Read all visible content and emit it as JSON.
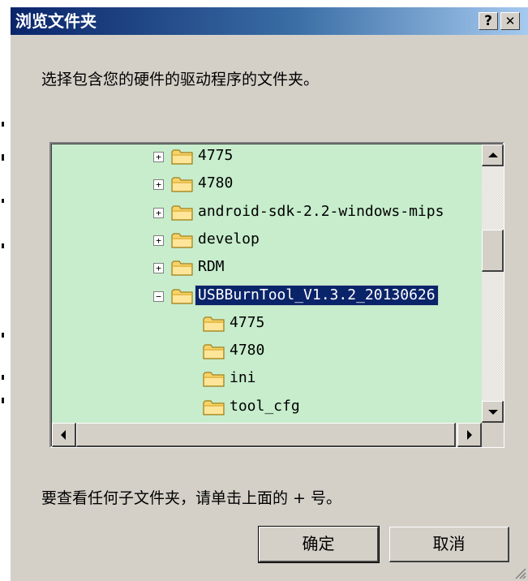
{
  "window": {
    "title": "浏览文件夹",
    "help_label": "?",
    "close_label": "✕"
  },
  "prompt": "选择包含您的硬件的驱动程序的文件夹。",
  "tree": {
    "rows": [
      {
        "label": "4775",
        "expander": "+",
        "level": 1,
        "selected": false
      },
      {
        "label": "4780",
        "expander": "+",
        "level": 1,
        "selected": false
      },
      {
        "label": "android-sdk-2.2-windows-mips",
        "expander": "+",
        "level": 1,
        "selected": false
      },
      {
        "label": "develop",
        "expander": "+",
        "level": 1,
        "selected": false
      },
      {
        "label": "RDM",
        "expander": "+",
        "level": 1,
        "selected": false
      },
      {
        "label": "USBBurnTool_V1.3.2_20130626",
        "expander": "−",
        "level": 1,
        "selected": true,
        "open": true
      },
      {
        "label": "4775",
        "expander": "",
        "level": 2,
        "selected": false
      },
      {
        "label": "4780",
        "expander": "",
        "level": 2,
        "selected": false
      },
      {
        "label": "ini",
        "expander": "",
        "level": 2,
        "selected": false
      },
      {
        "label": "tool_cfg",
        "expander": "",
        "level": 2,
        "selected": false
      }
    ],
    "folder_icon": "folder-icon",
    "colors": {
      "background": "#c7edcc",
      "selection": "#0a246a"
    }
  },
  "hint": "要查看任何子文件夹，请单击上面的 + 号。",
  "buttons": {
    "ok_label": "确定",
    "cancel_label": "取消"
  }
}
